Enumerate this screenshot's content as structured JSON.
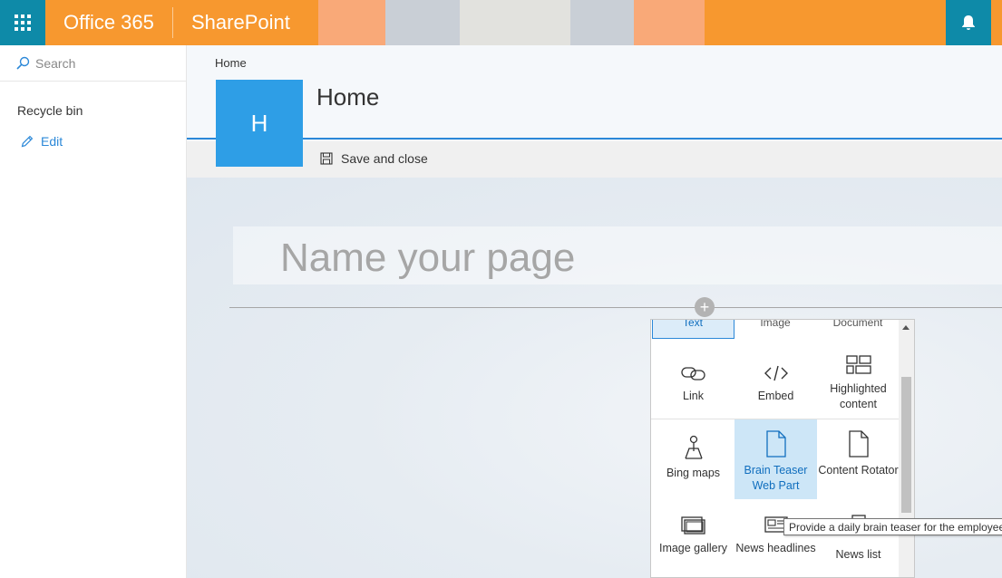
{
  "suitebar": {
    "app_launcher_icon": "waffle-icon",
    "brand": "Office 365",
    "site": "SharePoint",
    "stripes": [
      "#f9a978",
      "#c9cfd6",
      "#e2e2de",
      "#c9cfd6",
      "#f9a978"
    ],
    "notifications_icon": "bell-icon"
  },
  "leftnav": {
    "search_placeholder": "Search",
    "recycle_bin": "Recycle bin",
    "edit": "Edit"
  },
  "header": {
    "breadcrumb": "Home",
    "logo_letter": "H",
    "title": "Home"
  },
  "commandbar": {
    "save_close": "Save and close"
  },
  "canvas": {
    "page_name_placeholder": "Name your page"
  },
  "toolbox": {
    "top_row": [
      "Text",
      "Image",
      "Document"
    ],
    "tiles": [
      {
        "label": "Link",
        "icon": "link-icon"
      },
      {
        "label": "Embed",
        "icon": "embed-icon"
      },
      {
        "label": "Highlighted content",
        "icon": "highlighted-content-icon"
      },
      {
        "label": "Bing maps",
        "icon": "map-pin-icon"
      },
      {
        "label": "Brain Teaser Web Part",
        "icon": "document-icon"
      },
      {
        "label": "Content Rotator",
        "icon": "document-icon"
      },
      {
        "label": "Image gallery",
        "icon": "image-gallery-icon"
      },
      {
        "label": "News headlines",
        "icon": "news-icon"
      },
      {
        "label": "News list",
        "icon": "news-list-icon"
      }
    ]
  },
  "tooltip": "Provide a daily brain teaser for the employees",
  "colors": {
    "suitebar": "#f7982f",
    "accent": "#2b88d8",
    "teal": "#0e8aa8",
    "logo_tile": "#2e9ee6"
  }
}
